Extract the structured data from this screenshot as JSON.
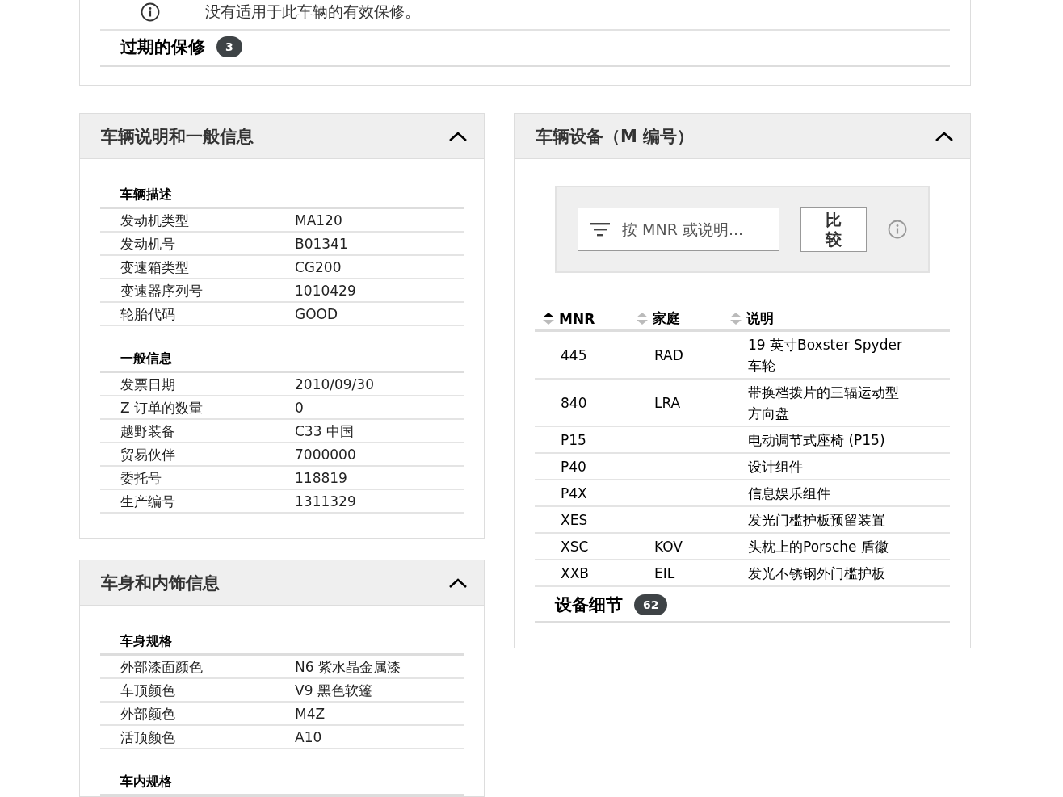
{
  "warranty": {
    "notice": "没有适用于此车辆的有效保修。",
    "expired": {
      "label": "过期的保修",
      "count": "3"
    }
  },
  "left_panels": [
    {
      "title": "车辆说明和一般信息",
      "expanded": true,
      "sections": [
        {
          "heading": "车辆描述",
          "rows": [
            [
              "发动机类型",
              "MA120"
            ],
            [
              "发动机号",
              "B01341"
            ],
            [
              "变速箱类型",
              "CG200"
            ],
            [
              "变速器序列号",
              "1010429"
            ],
            [
              "轮胎代码",
              "GOOD"
            ]
          ]
        },
        {
          "heading": "一般信息",
          "rows": [
            [
              "发票日期",
              "2010/09/30"
            ],
            [
              "Z 订单的数量",
              "0"
            ],
            [
              "越野装备",
              "C33 中国"
            ],
            [
              "贸易伙伴",
              "7000000"
            ],
            [
              "委托号",
              "118819"
            ],
            [
              "生产编号",
              "1311329"
            ]
          ]
        }
      ]
    },
    {
      "title": "车身和内饰信息",
      "expanded": true,
      "sections": [
        {
          "heading": "车身规格",
          "rows": [
            [
              "外部漆面颜色",
              "N6 紫水晶金属漆"
            ],
            [
              "车顶颜色",
              "V9 黑色软篷"
            ],
            [
              "外部颜色",
              "M4Z"
            ],
            [
              "活顶颜色",
              "A10"
            ]
          ]
        },
        {
          "heading": "车内规格"
        }
      ]
    }
  ],
  "equipment": {
    "title": "车辆设备（M 编号）",
    "expanded": true,
    "filter": {
      "placeholder": "按 MNR 或说明..."
    },
    "compare_button": "比较",
    "columns": [
      {
        "label": "MNR",
        "selected": true
      },
      {
        "label": "家庭",
        "selected": false
      },
      {
        "label": "说明",
        "selected": false
      }
    ],
    "rows": [
      [
        "445",
        "RAD",
        "19 英寸Boxster Spyder 车轮"
      ],
      [
        "840",
        "LRA",
        "带换档拨片的三辐运动型方向盘"
      ],
      [
        "P15",
        "",
        "电动调节式座椅 (P15)"
      ],
      [
        "P40",
        "",
        "设计组件"
      ],
      [
        "P4X",
        "",
        "信息娱乐组件"
      ],
      [
        "XES",
        "",
        "发光门槛护板预留装置"
      ],
      [
        "XSC",
        "KOV",
        "头枕上的Porsche 盾徽"
      ],
      [
        "XXB",
        "EIL",
        "发光不锈钢外门槛护板"
      ]
    ],
    "details": {
      "label": "设备细节",
      "count": "62"
    }
  }
}
